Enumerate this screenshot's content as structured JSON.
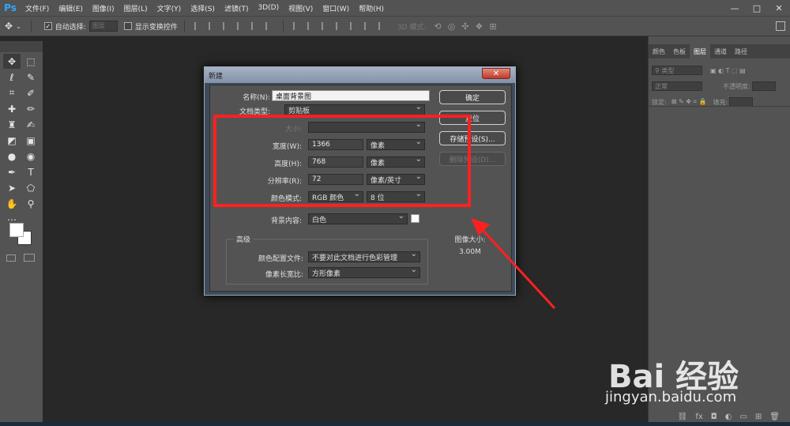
{
  "app": {
    "logo": "Ps"
  },
  "menubar": {
    "items": [
      "文件(F)",
      "编辑(E)",
      "图像(I)",
      "图层(L)",
      "文字(Y)",
      "选择(S)",
      "滤镜(T)",
      "3D(D)",
      "视图(V)",
      "窗口(W)",
      "帮助(H)"
    ],
    "window_controls": [
      "—",
      "□",
      "✕"
    ]
  },
  "optionsbar": {
    "auto_select_label": "自动选择:",
    "auto_select_value": "图层",
    "show_transform_label": "显示变换控件",
    "mode_3d_label": "3D 模式:"
  },
  "panel": {
    "tabs": [
      "颜色",
      "色板",
      "图层",
      "通道",
      "路径"
    ],
    "active_tab": "图层",
    "filter_kind": "类型",
    "blend_mode": "正常",
    "opacity_label": "不透明度:",
    "lock_label": "锁定:",
    "fill_label": "填充:"
  },
  "dialog": {
    "title": "新建",
    "name_label": "名称(N):",
    "name_value": "桌面背景图",
    "doc_type_label": "文档类型:",
    "doc_type_value": "剪贴板",
    "size_label": "大小:",
    "width_label": "宽度(W):",
    "width_value": "1366",
    "width_unit": "像素",
    "height_label": "高度(H):",
    "height_value": "768",
    "height_unit": "像素",
    "resolution_label": "分辨率(R):",
    "resolution_value": "72",
    "resolution_unit": "像素/英寸",
    "color_mode_label": "颜色模式:",
    "color_mode_value": "RGB 颜色",
    "bit_depth_value": "8 位",
    "bg_content_label": "背景内容:",
    "bg_content_value": "白色",
    "advanced_title": "高级",
    "color_profile_label": "颜色配置文件:",
    "color_profile_value": "不要对此文档进行色彩管理",
    "pixel_aspect_label": "像素长宽比:",
    "pixel_aspect_value": "方形像素",
    "ok_button": "确定",
    "reset_button": "复位",
    "save_preset_button": "存储预设(S)...",
    "delete_preset_button": "删除预设(D)...",
    "image_size_label": "图像大小:",
    "image_size_value": "3.00M"
  },
  "watermark": {
    "brand": "Bai  经验",
    "url": "jingyan.baidu.com"
  }
}
